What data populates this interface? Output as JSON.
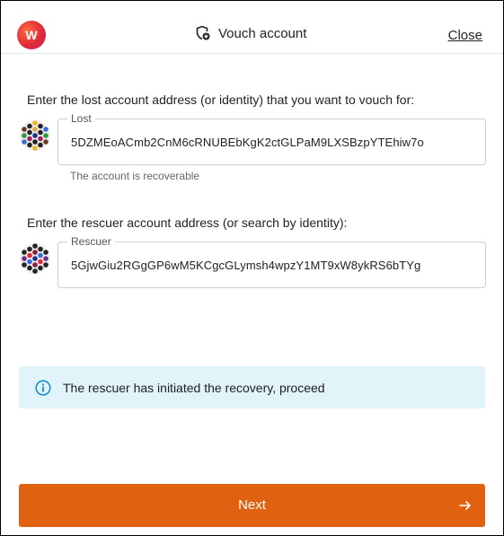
{
  "header": {
    "logo_letter": "W",
    "title": "Vouch account",
    "title_icon": "shield-plus-icon",
    "close_label": "Close"
  },
  "lost": {
    "prompt": "Enter the lost account address (or identity) that you want to vouch for:",
    "legend": "Lost",
    "address": "5DZMEoACmb2CnM6cRNUBEbKgK2ctGLPaM9LXSBzpYTEhiw7o",
    "status": "The account is recoverable"
  },
  "rescuer": {
    "prompt": "Enter the rescuer account address (or search by identity):",
    "legend": "Rescuer",
    "address": "5GjwGiu2RGgGP6wM5KCgcGLymsh4wpzY1MT9xW8ykRS6bTYg"
  },
  "alert": {
    "icon": "info-icon",
    "text": "The rescuer has initiated the recovery, proceed",
    "color": "#e0f4fa"
  },
  "next_button": {
    "label": "Next",
    "icon": "arrow-right-icon",
    "color": "#e06210"
  }
}
